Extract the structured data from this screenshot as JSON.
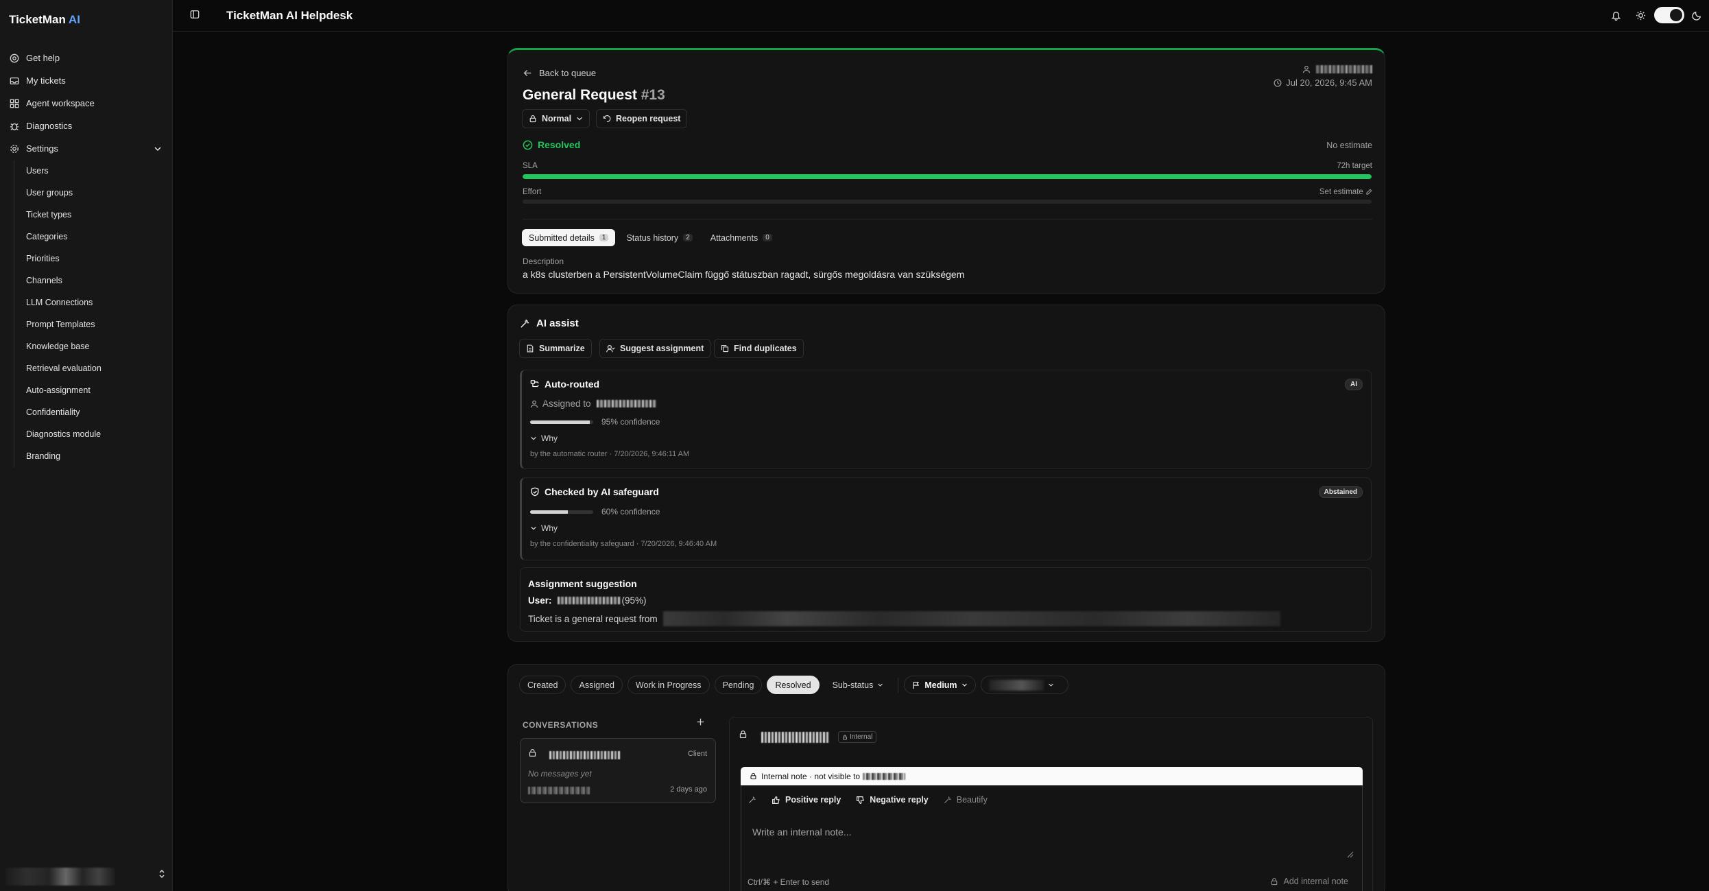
{
  "brand": {
    "name": "TicketMan",
    "suffix": "AI"
  },
  "app_title": "TicketMan AI Helpdesk",
  "colors": {
    "accent": "#22c55e",
    "link": "#60a5fa",
    "background": "#0a0a0a",
    "card": "#141414"
  },
  "sidebar": {
    "items": [
      {
        "label": "Get help",
        "icon": "help-circle-icon"
      },
      {
        "label": "My tickets",
        "icon": "inbox-icon"
      },
      {
        "label": "Agent workspace",
        "icon": "grid-icon"
      },
      {
        "label": "Diagnostics",
        "icon": "bug-icon"
      },
      {
        "label": "Settings",
        "icon": "gear-icon"
      }
    ],
    "settings_items": [
      "Users",
      "User groups",
      "Ticket types",
      "Categories",
      "Priorities",
      "Channels",
      "LLM Connections",
      "Prompt Templates",
      "Knowledge base",
      "Retrieval evaluation",
      "Auto-assignment",
      "Confidentiality",
      "Diagnostics module",
      "Branding"
    ]
  },
  "ticket": {
    "back_label": "Back to queue",
    "title": "General Request",
    "number": "#13",
    "date": "Jul 20, 2026, 9:45 AM",
    "priority": "Normal",
    "reopen_label": "Reopen request",
    "status": "Resolved",
    "estimate": "No estimate",
    "sla_label": "SLA",
    "sla_target": "72h target",
    "sla_progress": 1.0,
    "effort_label": "Effort",
    "set_estimate": "Set estimate",
    "effort_progress": 0.0,
    "tabs": [
      {
        "label": "Submitted details",
        "count": "1"
      },
      {
        "label": "Status history",
        "count": "2"
      },
      {
        "label": "Attachments",
        "count": "0"
      }
    ],
    "description_label": "Description",
    "description": "a k8s clusterben a PersistentVolumeClaim függő státuszban ragadt, sürgős megoldásra van szükségem"
  },
  "ai_assist": {
    "title": "AI assist",
    "buttons": [
      "Summarize",
      "Suggest assignment",
      "Find duplicates"
    ],
    "auto_routed": {
      "title": "Auto-routed",
      "badge": "AI",
      "assigned_prefix": "Assigned to",
      "confidence": 0.95,
      "confidence_text": "95% confidence",
      "why": "Why",
      "by_line": "by the automatic router · 7/20/2026, 9:46:11 AM"
    },
    "safeguard": {
      "title": "Checked by AI safeguard",
      "badge": "Abstained",
      "confidence": 0.6,
      "confidence_text": "60% confidence",
      "why": "Why",
      "by_line": "by the confidentiality safeguard · 7/20/2026, 9:46:40 AM"
    },
    "suggestion": {
      "title": "Assignment suggestion",
      "user_label": "User:",
      "pct": "(95%)",
      "reason_prefix": "Ticket is a general request from"
    }
  },
  "workflow": {
    "statuses": [
      "Created",
      "Assigned",
      "Work in Progress",
      "Pending",
      "Resolved"
    ],
    "active_status": "Resolved",
    "sub_status": "Sub-status",
    "priority": "Medium"
  },
  "conversations": {
    "title": "CONVERSATIONS",
    "item": {
      "tag": "Client",
      "empty": "No messages yet",
      "time": "2 days ago"
    }
  },
  "thread": {
    "badge": "Internal",
    "banner": "Internal note · not visible to",
    "tools": [
      "Positive reply",
      "Negative reply",
      "Beautify"
    ],
    "placeholder": "Write an internal note...",
    "hint": "Ctrl/⌘ + Enter to send",
    "send_label": "Add internal note"
  }
}
